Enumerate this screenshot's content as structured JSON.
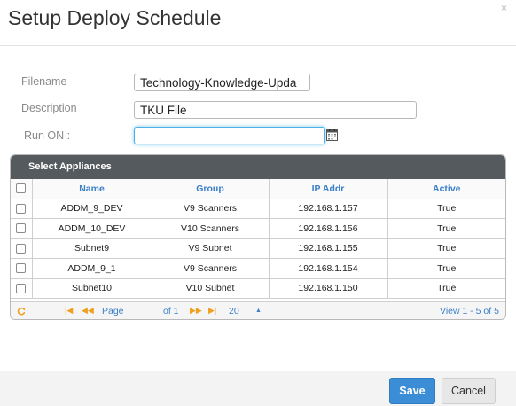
{
  "dialog": {
    "title": "Setup Deploy Schedule",
    "close_glyph": "×"
  },
  "form": {
    "filename_label": "Filename",
    "filename_value": "Technology-Knowledge-Upda",
    "description_label": "Description",
    "description_value": "TKU File",
    "run_on_label": "Run ON :",
    "run_on_value": ""
  },
  "appliances": {
    "caption": "Select Appliances",
    "columns": [
      "Name",
      "Group",
      "IP Addr",
      "Active"
    ],
    "rows": [
      {
        "name": "ADDM_9_DEV",
        "group": "V9 Scanners",
        "ip": "192.168.1.157",
        "active": "True"
      },
      {
        "name": "ADDM_10_DEV",
        "group": "V10 Scanners",
        "ip": "192.168.1.156",
        "active": "True"
      },
      {
        "name": "Subnet9",
        "group": "V9 Subnet",
        "ip": "192.168.1.155",
        "active": "True"
      },
      {
        "name": "ADDM_9_1",
        "group": "V9 Scanners",
        "ip": "192.168.1.154",
        "active": "True"
      },
      {
        "name": "Subnet10",
        "group": "V10 Subnet",
        "ip": "192.168.1.150",
        "active": "True"
      }
    ]
  },
  "pager": {
    "page_label": "Page",
    "page_value": "",
    "of_label": "of 1",
    "page_size": "20",
    "view_text": "View 1 - 5 of 5",
    "refresh_icon": "refresh-icon",
    "first_icon": "first-page-icon",
    "prev_icon": "prev-page-icon",
    "next_icon": "next-page-icon",
    "last_icon": "last-page-icon"
  },
  "footer": {
    "save_label": "Save",
    "cancel_label": "Cancel"
  },
  "colors": {
    "accent": "#3b8ed6",
    "header_link": "#3a7fc8",
    "caption_bg": "#555a5e",
    "pager_icon": "#f0a020"
  }
}
